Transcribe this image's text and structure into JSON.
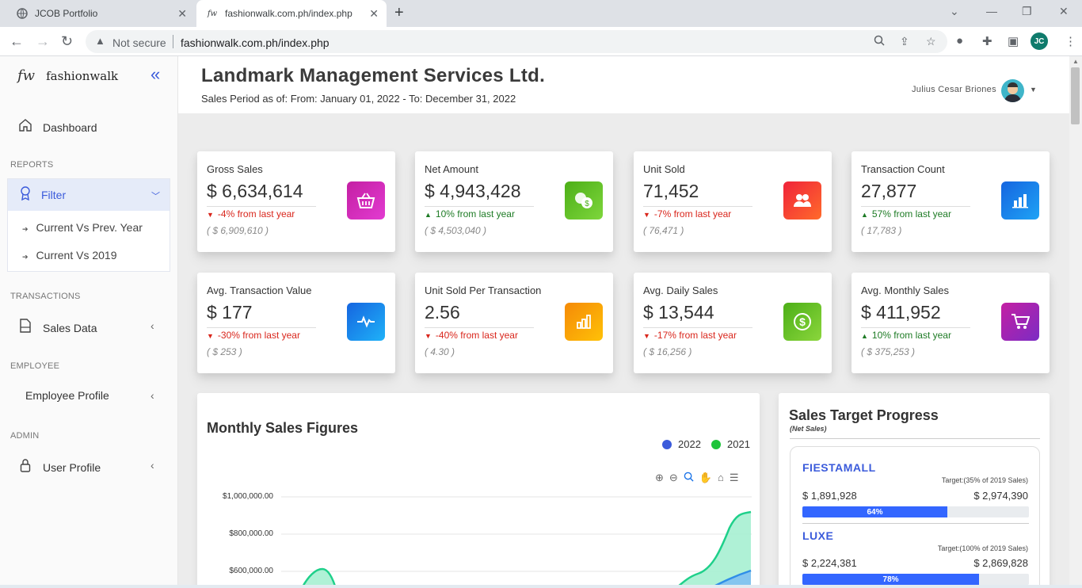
{
  "browser": {
    "tabs": [
      {
        "title": "JCOB Portfolio",
        "active": false
      },
      {
        "title": "fashionwalk.com.ph/index.php",
        "active": true
      }
    ],
    "security_label": "Not secure",
    "url": "fashionwalk.com.ph/index.php",
    "profile_initials": "JC"
  },
  "sidebar": {
    "brand_logo": "fw",
    "brand_name": "fashionwalk",
    "dashboard": "Dashboard",
    "sections": {
      "reports": "REPORTS",
      "transactions": "TRANSACTIONS",
      "employee": "EMPLOYEE",
      "admin": "ADMIN"
    },
    "filter": {
      "label": "Filter",
      "items": [
        "Current Vs Prev. Year",
        "Current Vs 2019"
      ]
    },
    "sales_data": "Sales Data",
    "employee_profile": "Employee Profile",
    "user_profile": "User Profile"
  },
  "header": {
    "company": "Landmark Management Services Ltd.",
    "period": "Sales Period as of: From: January 01, 2022 - To: December 31, 2022",
    "user_name": "Julius Cesar Briones"
  },
  "cards": [
    {
      "label": "Gross Sales",
      "value": "$ 6,634,614",
      "change": "-4% from last year",
      "direction": "down",
      "prev": "( $ 6,909,610 )",
      "icon": "basket-icon",
      "colors": [
        "#c41fa3",
        "#e23bd1"
      ]
    },
    {
      "label": "Net Amount",
      "value": "$ 4,943,428",
      "change": "10% from last year",
      "direction": "up",
      "prev": "( $ 4,503,040 )",
      "icon": "coins-icon",
      "colors": [
        "#4caf17",
        "#7ed63c"
      ]
    },
    {
      "label": "Unit Sold",
      "value": "71,452",
      "change": "-7% from last year",
      "direction": "down",
      "prev": "( 76,471 )",
      "icon": "users-icon",
      "colors": [
        "#f0233a",
        "#ff6a2b"
      ]
    },
    {
      "label": "Transaction Count",
      "value": "27,877",
      "change": "57% from last year",
      "direction": "up",
      "prev": "( 17,783 )",
      "icon": "bar-chart-icon",
      "colors": [
        "#1565e0",
        "#1fa3f5"
      ]
    },
    {
      "label": "Avg. Transaction Value",
      "value": "$ 177",
      "change": "-30% from last year",
      "direction": "down",
      "prev": "( $ 253 )",
      "icon": "pulse-icon",
      "colors": [
        "#1565e0",
        "#1fb2f8"
      ]
    },
    {
      "label": "Unit Sold Per Transaction",
      "value": "2.56",
      "change": "-40% from last year",
      "direction": "down",
      "prev": "( 4.30 )",
      "icon": "column-chart-icon",
      "colors": [
        "#f58a07",
        "#ffc107"
      ]
    },
    {
      "label": "Avg. Daily Sales",
      "value": "$ 13,544",
      "change": "-17% from last year",
      "direction": "down",
      "prev": "( $ 16,256 )",
      "icon": "dollar-coin-icon",
      "colors": [
        "#4caf17",
        "#8bd63c"
      ]
    },
    {
      "label": "Avg. Monthly Sales",
      "value": "$ 411,952",
      "change": "10% from last year",
      "direction": "up",
      "prev": "( $ 375,253 )",
      "icon": "cart-icon",
      "colors": [
        "#c41fa3",
        "#7b2cc4"
      ]
    }
  ],
  "monthly_chart": {
    "title": "Monthly Sales Figures",
    "legend": [
      {
        "name": "2022",
        "color": "#3b5bdb"
      },
      {
        "name": "2021",
        "color": "#1ec43a"
      }
    ],
    "y_ticks": [
      "$1,000,000.00",
      "$800,000.00",
      "$600,000.00"
    ]
  },
  "chart_data": {
    "type": "area",
    "title": "Monthly Sales Figures",
    "ylim": [
      600000,
      1000000
    ],
    "y_ticks": [
      1000000,
      800000,
      600000
    ],
    "series": [
      {
        "name": "2022",
        "color": "#2f8ee8",
        "values_partial_visible": [
          600000
        ]
      },
      {
        "name": "2021",
        "color": "#1ed08a",
        "values_partial_visible": [
          610000,
          920000
        ]
      }
    ],
    "grid": true,
    "legend": "top-right"
  },
  "target_panel": {
    "title": "Sales Target Progress",
    "subtitle": "(Net Sales)",
    "stores": [
      {
        "name": "FIESTAMALL",
        "target_note": "Target:(35% of 2019 Sales)",
        "actual": "$ 1,891,928",
        "target": "$ 2,974,390",
        "progress": 64,
        "progress_label": "64%"
      },
      {
        "name": "LUXE",
        "target_note": "Target:(100% of 2019 Sales)",
        "actual": "$ 2,224,381",
        "target": "$ 2,869,828",
        "progress": 78,
        "progress_label": "78%"
      }
    ]
  }
}
